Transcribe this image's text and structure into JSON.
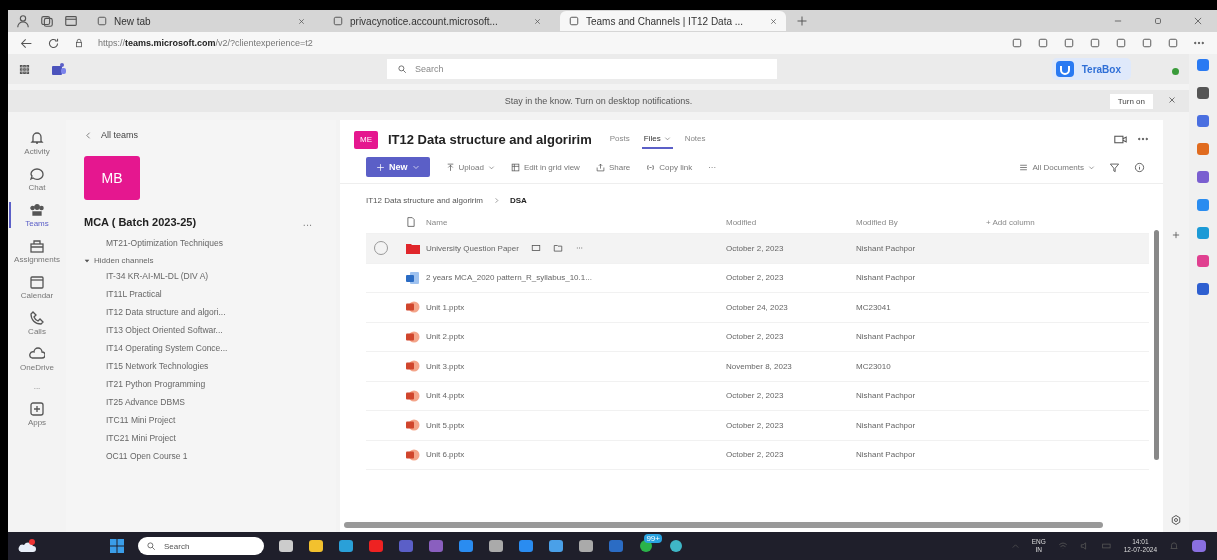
{
  "browser": {
    "tabs": [
      {
        "title": "New tab",
        "selected": false
      },
      {
        "title": "privacynotice.account.microsoft...",
        "selected": false
      },
      {
        "title": "Teams and Channels | IT12 Data ...",
        "selected": true
      }
    ],
    "address": "https://**teams.microsoft.com**/v2/?clientexperience=t2"
  },
  "teams_header": {
    "search_placeholder": "Search",
    "popup": "TeraBox"
  },
  "notification": {
    "text": "Stay in the know. Turn on desktop notifications.",
    "button": "Turn on"
  },
  "rail": [
    {
      "label": "Activity",
      "selected": false
    },
    {
      "label": "Chat",
      "selected": false
    },
    {
      "label": "Teams",
      "selected": true
    },
    {
      "label": "Assignments",
      "selected": false
    },
    {
      "label": "Calendar",
      "selected": false
    },
    {
      "label": "Calls",
      "selected": false
    },
    {
      "label": "OneDrive",
      "selected": false
    },
    {
      "label": "...",
      "selected": false
    },
    {
      "label": "Apps",
      "selected": false
    }
  ],
  "channel_panel": {
    "back": "All teams",
    "avatar": "MB",
    "team": "MCA ( Batch 2023-25)",
    "more": "...",
    "channels": [
      {
        "name": "MT21-Optimization Techniques",
        "selected": false
      }
    ],
    "hidden": {
      "label": "Hidden channels",
      "expanded": true,
      "children": [
        {
          "name": "IT-34 KR-AI-ML-DL (DIV A)",
          "selected": false
        },
        {
          "name": "IT11L Practical",
          "selected": false
        },
        {
          "name": "IT12 Data structure and algori...",
          "selected": false
        },
        {
          "name": "IT13 Object Oriented Softwar...",
          "selected": false
        },
        {
          "name": "IT14 Operating System Conce...",
          "selected": false
        },
        {
          "name": "IT15 Network Technologies",
          "selected": false
        },
        {
          "name": "IT21 Python Programming",
          "selected": false
        },
        {
          "name": "IT25 Advance DBMS",
          "selected": false
        },
        {
          "name": "ITC11 Mini Project",
          "selected": false
        },
        {
          "name": "ITC21 Mini Project",
          "selected": false
        },
        {
          "name": "OC11 Open Course 1",
          "selected": false
        }
      ]
    }
  },
  "channel": {
    "avatar": "ME",
    "title": "IT12 Data structure and algoririm",
    "tabs": [
      {
        "label": "Posts",
        "selected": false
      },
      {
        "label": "Files",
        "selected": true
      },
      {
        "label": "Notes",
        "selected": false
      }
    ]
  },
  "toolbar": {
    "new": "New",
    "upload": "Upload",
    "edit": "Edit in grid view",
    "share": "Share",
    "copy": "Copy link",
    "more": "···",
    "view": "All Documents"
  },
  "breadcrumb": [
    "IT12 Data structure and algoririm",
    "DSA"
  ],
  "table": {
    "columns": [
      "Name",
      "Modified",
      "Modified By",
      "+ Add column"
    ],
    "rows": [
      {
        "kind": "folder",
        "name": "University Question Paper",
        "modified": "October 2, 2023",
        "by": "Nishant Pachpor",
        "hovered": true
      },
      {
        "kind": "word",
        "name": "2 years MCA_2020 pattern_R_syllabus_10.1...",
        "modified": "October 2, 2023",
        "by": "Nishant Pachpor",
        "hovered": false
      },
      {
        "kind": "ppt",
        "name": "Unit 1.pptx",
        "modified": "October 24, 2023",
        "by": "MC23041",
        "hovered": false
      },
      {
        "kind": "ppt",
        "name": "Unit 2.pptx",
        "modified": "October 2, 2023",
        "by": "Nishant Pachpor",
        "hovered": false
      },
      {
        "kind": "ppt",
        "name": "Unit 3.pptx",
        "modified": "November 8, 2023",
        "by": "MC23010",
        "hovered": false
      },
      {
        "kind": "ppt",
        "name": "Unit 4.pptx",
        "modified": "October 2, 2023",
        "by": "Nishant Pachpor",
        "hovered": false
      },
      {
        "kind": "ppt",
        "name": "Unit 5.pptx",
        "modified": "October 2, 2023",
        "by": "Nishant Pachpor",
        "hovered": false
      },
      {
        "kind": "ppt",
        "name": "Unit 6.pptx",
        "modified": "October 2, 2023",
        "by": "Nishant Pachpor",
        "hovered": false
      }
    ]
  },
  "taskbar": {
    "search_placeholder": "Search",
    "badge": "99+",
    "lang": "ENG",
    "region": "IN",
    "time": "14:01",
    "date": "12-07-2024"
  }
}
